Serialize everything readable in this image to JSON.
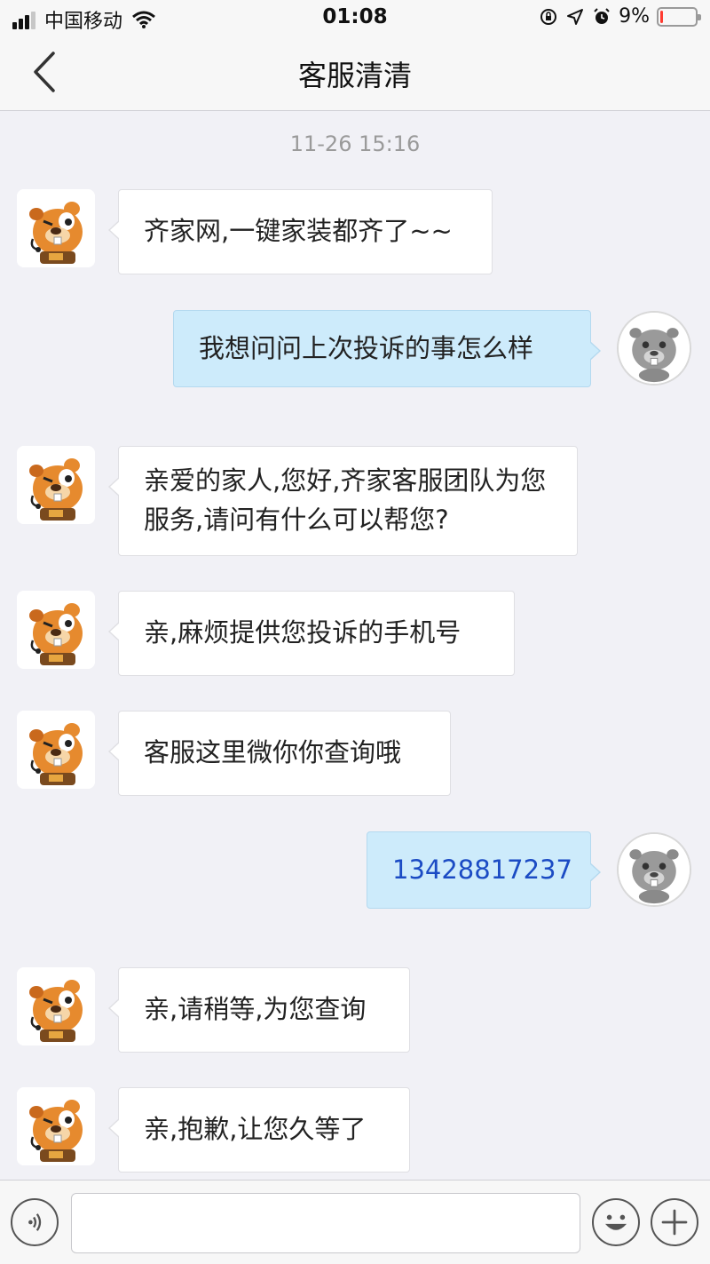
{
  "status_bar": {
    "carrier": "中国移动",
    "time": "01:08",
    "battery_percent_label": "9%",
    "battery_level": 0.09,
    "icons": [
      "signal-icon",
      "wifi-icon",
      "orientation-lock-icon",
      "location-arrow-icon",
      "alarm-icon",
      "battery-icon"
    ]
  },
  "nav": {
    "title": "客服清清",
    "back_icon": "back-chevron-icon"
  },
  "chat": {
    "timestamp": "11-26 15:16",
    "messages": [
      {
        "side": "in",
        "text": "齐家网,一键家装都齐了~~"
      },
      {
        "side": "out",
        "text": "我想问问上次投诉的事怎么样"
      },
      {
        "side": "in",
        "text": "亲爱的家人,您好,齐家客服团队为您服务,请问有什么可以帮您?"
      },
      {
        "side": "in",
        "text": "亲,麻烦提供您投诉的手机号"
      },
      {
        "side": "in",
        "text": "客服这里微你你查询哦"
      },
      {
        "side": "out",
        "text": "13428817237"
      },
      {
        "side": "in",
        "text": "亲,请稍等,为您查询"
      },
      {
        "side": "in",
        "text": "亲,抱歉,让您久等了"
      }
    ]
  },
  "input_bar": {
    "voice_icon": "voice-icon",
    "text_value": "",
    "emoji_icon": "emoji-icon",
    "plus_icon": "plus-icon"
  },
  "colors": {
    "background": "#f1f1f6",
    "incoming_bubble": "#ffffff",
    "outgoing_bubble": "#cdebfb",
    "phone_link": "#1b4bc4",
    "battery_low": "#ff3b30"
  }
}
